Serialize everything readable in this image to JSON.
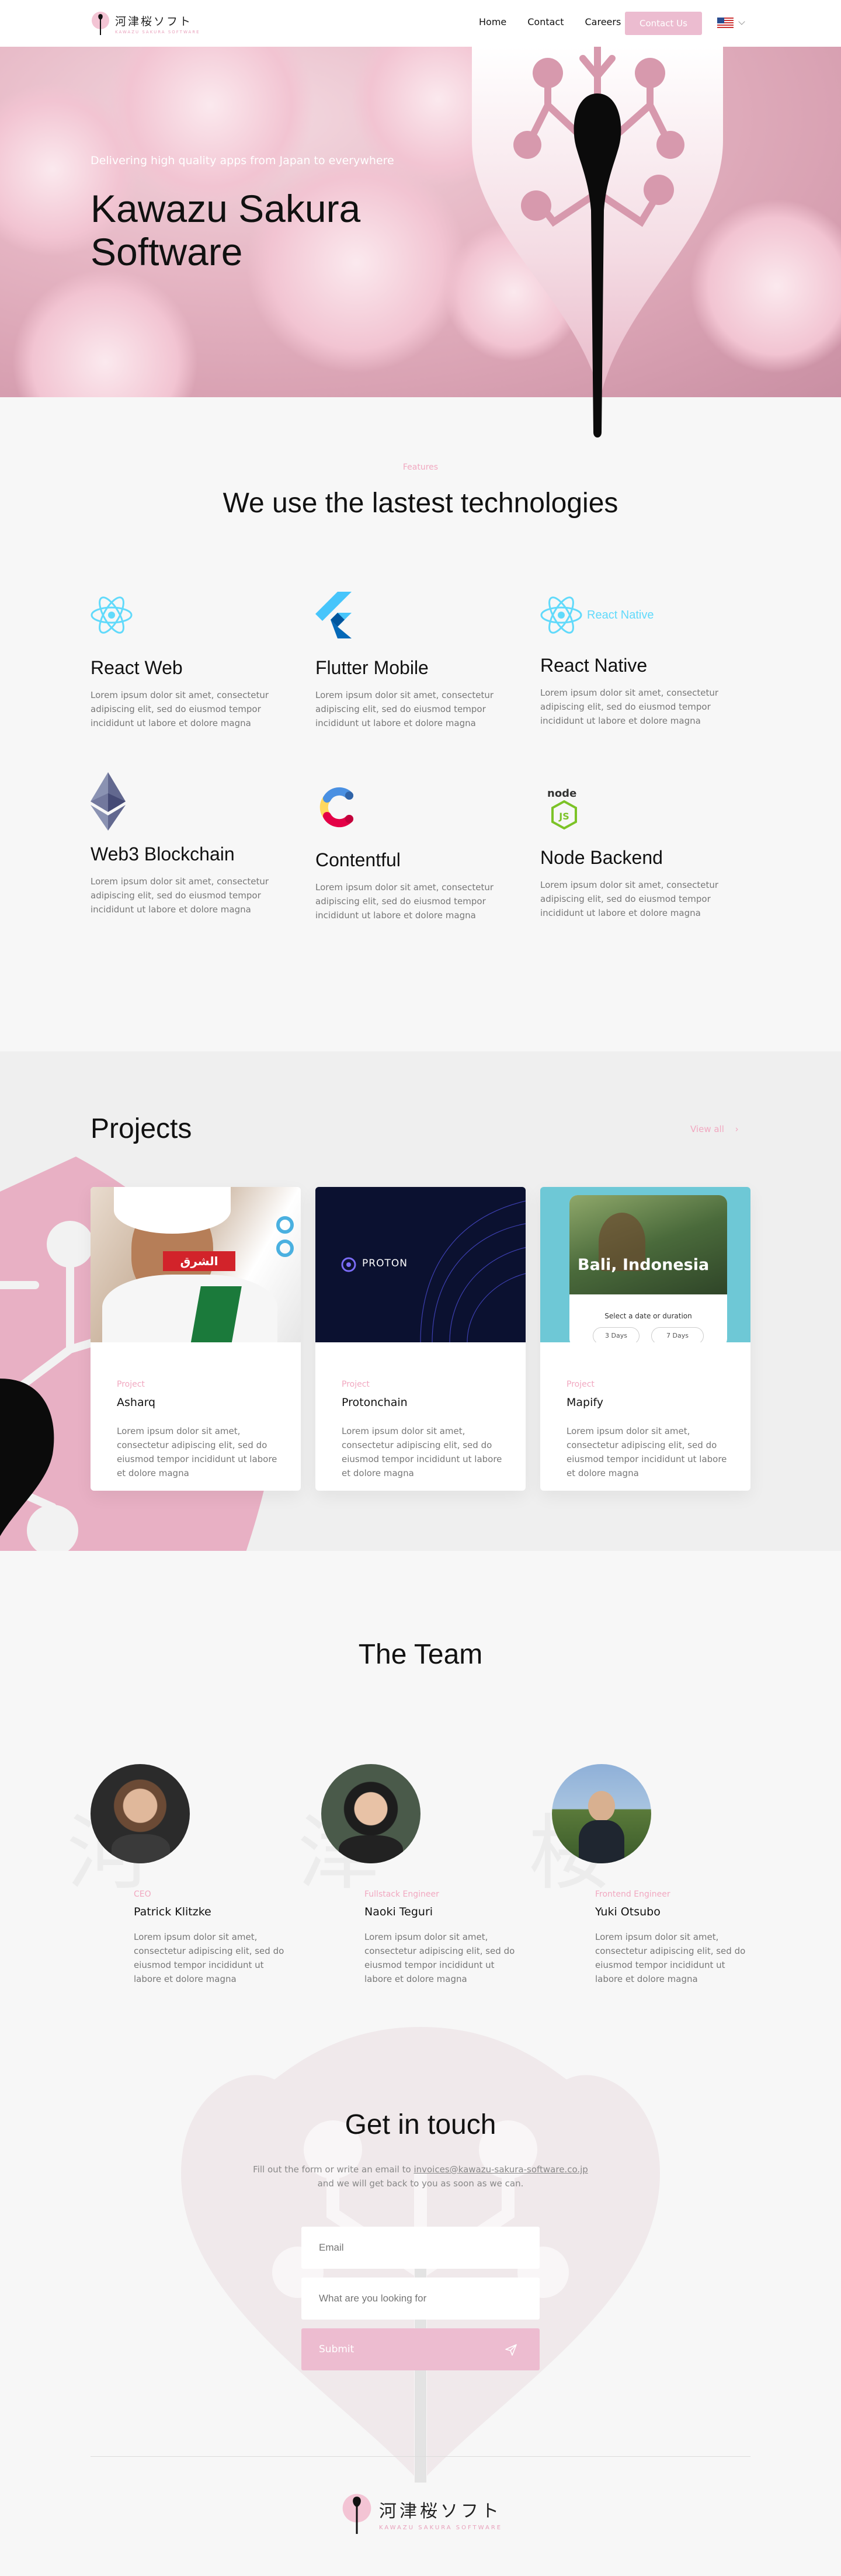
{
  "nav": {
    "logo_jp": "河津桜ソフト",
    "logo_en": "KAWAZU SAKURA SOFTWARE",
    "links": [
      "Home",
      "Contact",
      "Careers"
    ],
    "cta": "Contact Us",
    "language": "en-US flag"
  },
  "hero": {
    "subtitle": "Delivering high quality apps from Japan to everywhere",
    "title_line1": "Kawazu Sakura",
    "title_line2": "Software"
  },
  "features": {
    "label": "Features",
    "title": "We use the lastest technologies",
    "items": [
      {
        "title": "React Web",
        "icon": "react-icon",
        "text": "Lorem ipsum dolor sit amet, consectetur adipiscing elit, sed do eiusmod tempor incididunt ut labore et dolore magna"
      },
      {
        "title": "Flutter Mobile",
        "icon": "flutter-icon",
        "text": "Lorem ipsum dolor sit amet, consectetur adipiscing elit, sed do eiusmod tempor incididunt ut labore et dolore magna"
      },
      {
        "title": "React Native",
        "icon": "react-native-icon",
        "logo_text": "React Native",
        "text": "Lorem ipsum dolor sit amet, consectetur adipiscing elit, sed do eiusmod tempor incididunt ut labore et dolore magna"
      },
      {
        "title": "Web3 Blockchain",
        "icon": "ethereum-icon",
        "text": "Lorem ipsum dolor sit amet, consectetur adipiscing elit, sed do eiusmod tempor incididunt ut labore et dolore magna"
      },
      {
        "title": "Contentful",
        "icon": "contentful-icon",
        "text": "Lorem ipsum dolor sit amet, consectetur adipiscing elit, sed do eiusmod tempor incididunt ut labore et dolore magna"
      },
      {
        "title": "Node Backend",
        "icon": "nodejs-icon",
        "logo_text": "node",
        "text": "Lorem ipsum dolor sit amet, consectetur adipiscing elit, sed do eiusmod tempor incididunt ut labore et dolore magna"
      }
    ]
  },
  "projects": {
    "title": "Projects",
    "view_all": "View all",
    "cards": [
      {
        "label": "Project",
        "name": "Asharq",
        "badge": "الشرق",
        "text": "Lorem ipsum dolor sit amet, consectetur adipiscing elit, sed do eiusmod tempor incididunt ut labore et dolore magna"
      },
      {
        "label": "Project",
        "name": "Protonchain",
        "badge": "PROTON",
        "text": "Lorem ipsum dolor sit amet, consectetur adipiscing elit, sed do eiusmod tempor incididunt ut labore et dolore magna"
      },
      {
        "label": "Project",
        "name": "Mapify",
        "badge": "Bali, Indonesia",
        "screen_text": "Select a date or duration",
        "chip1": "3 Days",
        "chip2": "7 Days",
        "text": "Lorem ipsum dolor sit amet, consectetur adipiscing elit, sed do eiusmod tempor incididunt ut labore et dolore magna"
      }
    ]
  },
  "team": {
    "title": "The Team",
    "members": [
      {
        "role": "CEO",
        "name": "Patrick Klitzke",
        "ghost": "河",
        "text": "Lorem ipsum dolor sit amet, consectetur adipiscing elit, sed do eiusmod tempor incididunt ut labore et dolore magna"
      },
      {
        "role": "Fullstack Engineer",
        "name": "Naoki Teguri",
        "ghost": "津",
        "text": "Lorem ipsum dolor sit amet, consectetur adipiscing elit, sed do eiusmod tempor incididunt ut labore et dolore magna"
      },
      {
        "role": "Frontend Engineer",
        "name": "Yuki Otsubo",
        "ghost": "桜",
        "text": "Lorem ipsum dolor sit amet, consectetur adipiscing elit, sed do eiusmod tempor incididunt ut labore et dolore magna"
      }
    ]
  },
  "contact": {
    "title": "Get in touch",
    "text_before": "Fill out the form or write an email to ",
    "email": "invoices@kawazu-sakura-software.co.jp",
    "text_after": "and we will get back to you as soon as we can.",
    "email_placeholder": "Email",
    "message_placeholder": "What are you looking for",
    "submit": "Submit"
  },
  "footer": {
    "logo_jp": "河津桜ソフト",
    "logo_en": "KAWAZU SAKURA SOFTWARE"
  },
  "colors": {
    "accent": "#f1a8c0",
    "button": "#ecbcd0",
    "dark": "#111111"
  }
}
